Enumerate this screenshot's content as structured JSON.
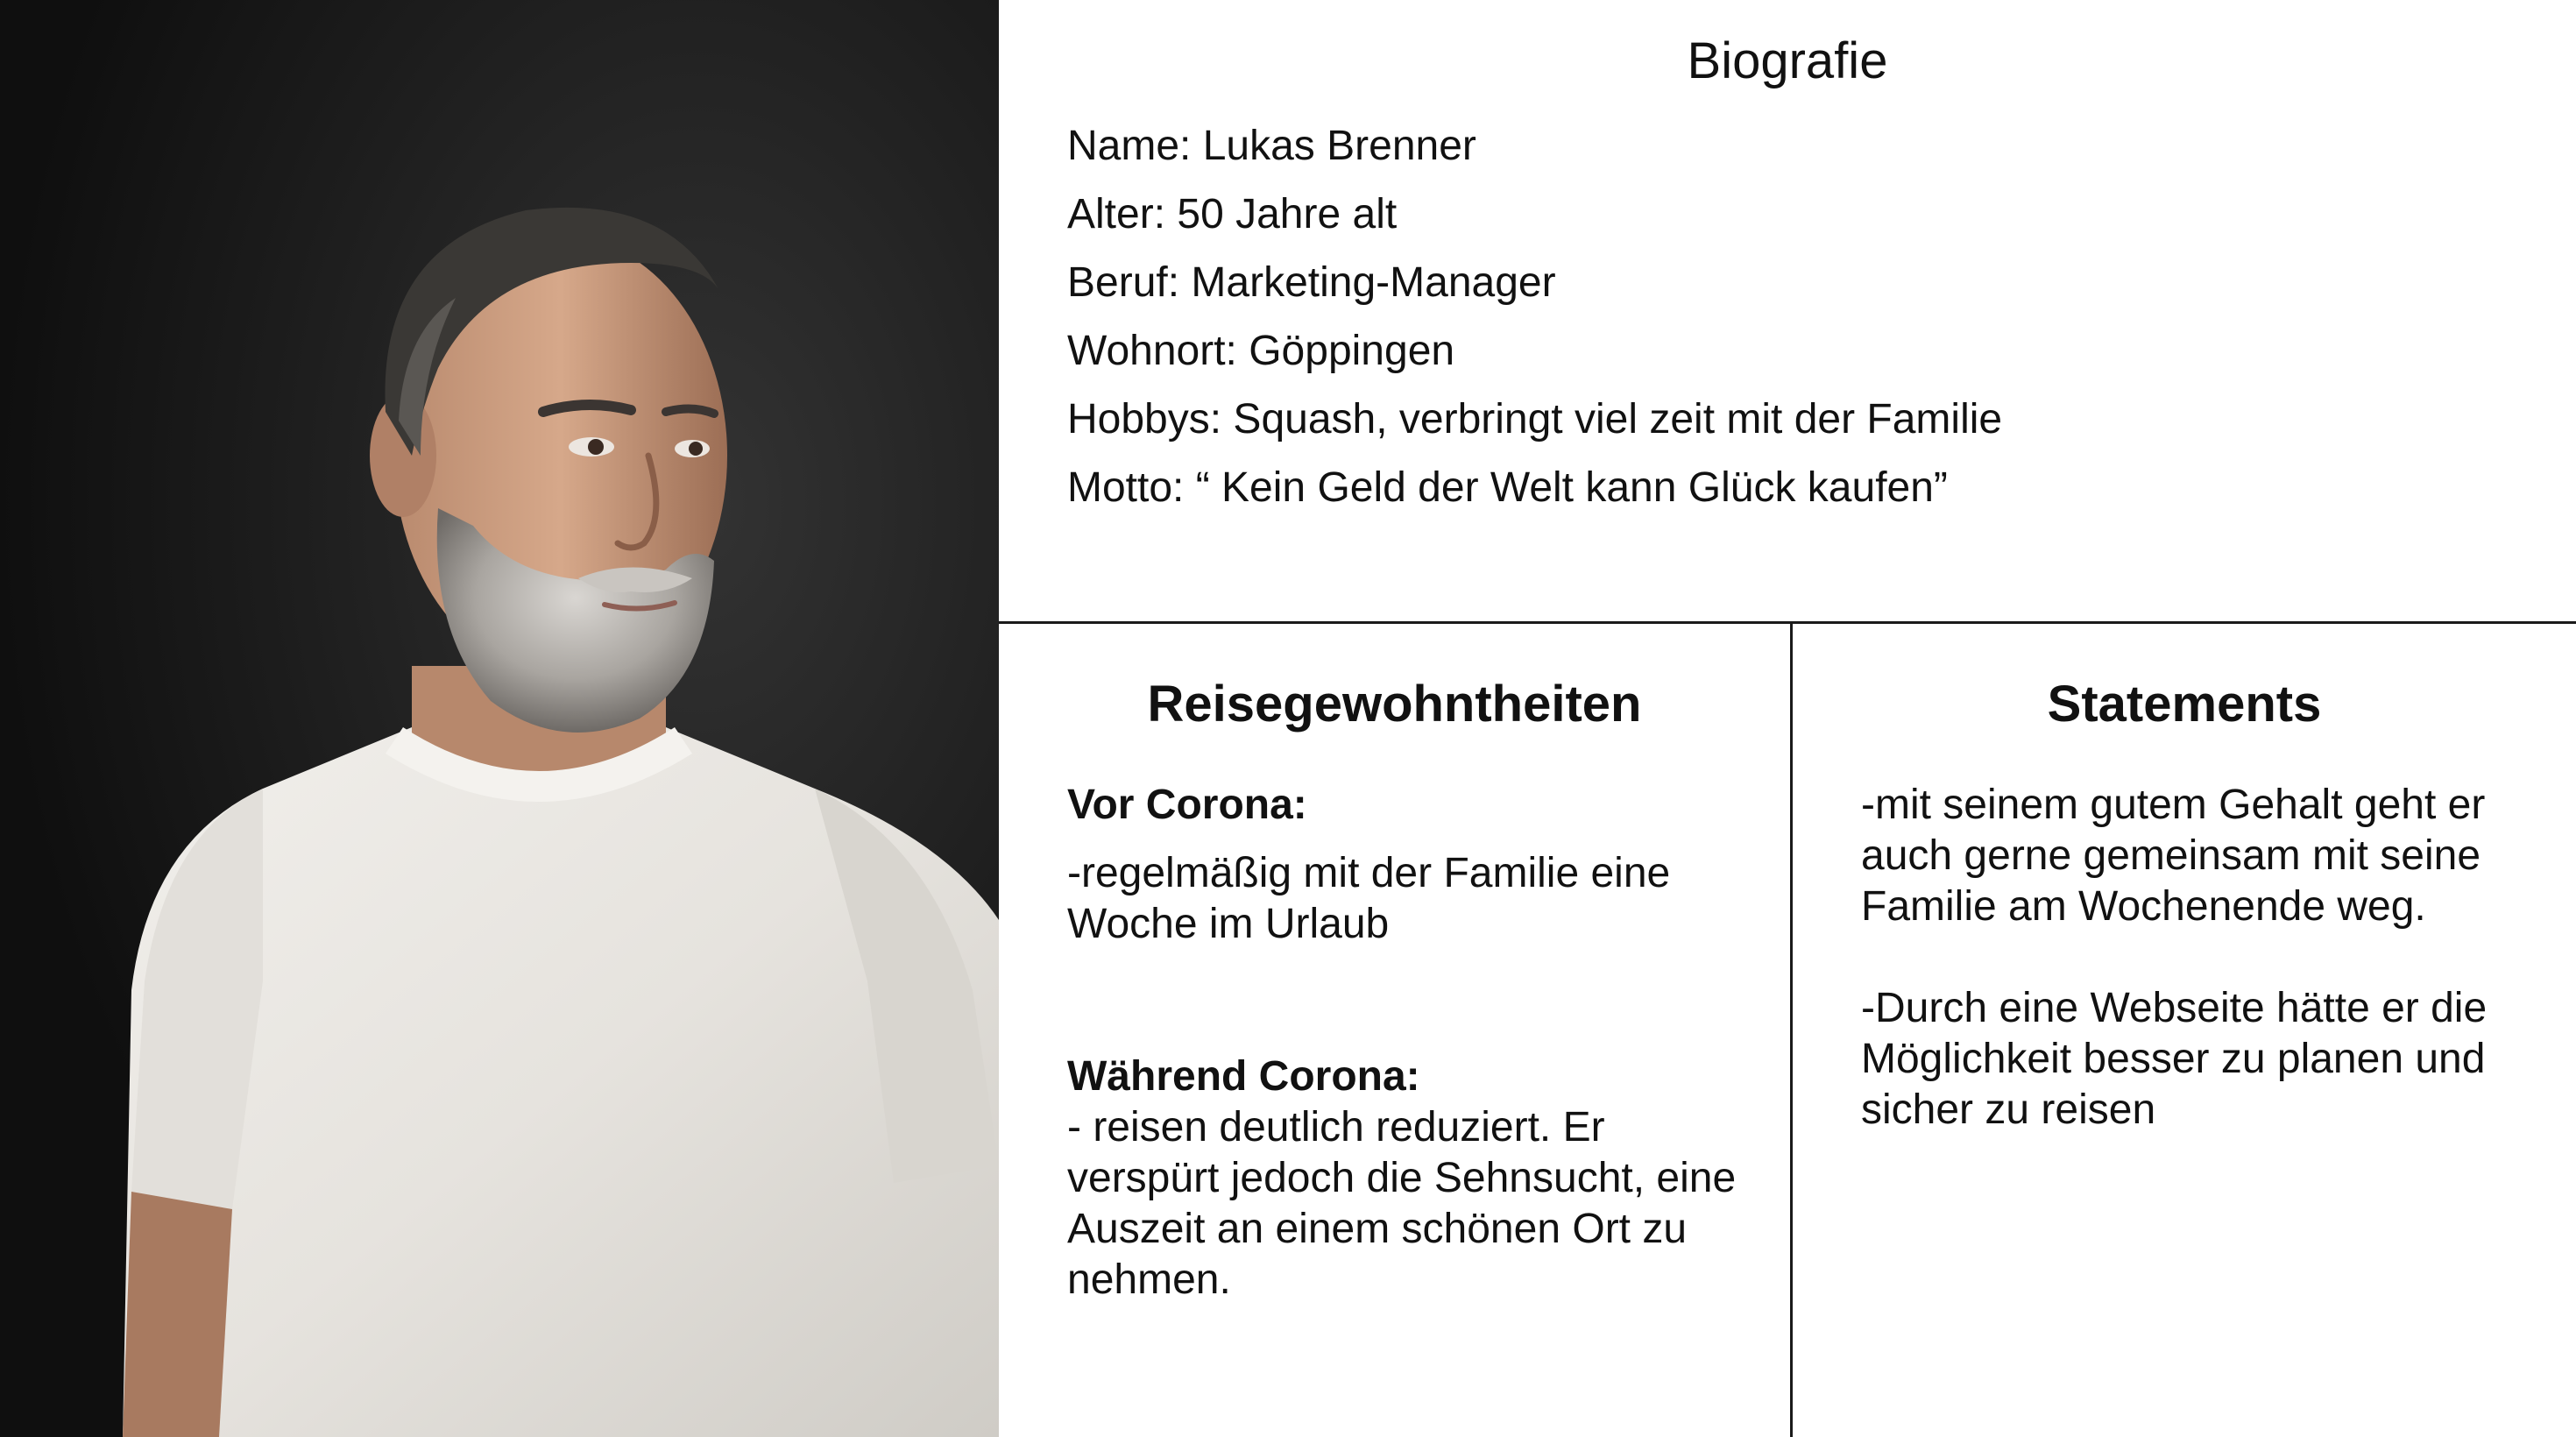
{
  "biography": {
    "title": "Biografie",
    "lines": [
      "Name: Lukas Brenner",
      "Alter: 50 Jahre alt",
      "Beruf: Marketing-Manager",
      "Wohnort: Göppingen",
      "Hobbys: Squash, verbringt viel zeit mit der Familie",
      "Motto: “ Kein Geld der Welt kann Glück kaufen”"
    ]
  },
  "travel_habits": {
    "title": "Reisegewohntheiten",
    "before": {
      "heading": "Vor Corona:",
      "text": "-regelmäßig mit der Familie eine Woche im Urlaub"
    },
    "during": {
      "heading": "Während Corona:",
      "text": "- reisen deutlich reduziert. Er verspürt jedoch die Sehnsucht, eine Auszeit an einem schönen Ort zu nehmen."
    }
  },
  "statements": {
    "title": "Statements",
    "items": [
      "-mit seinem gutem Gehalt geht er auch gerne gemeinsam mit seine Familie am Wochenende weg.",
      "-Durch eine Webseite hätte er die Möglichkeit besser zu planen und sicher zu reisen"
    ]
  },
  "colors": {
    "text": "#111111",
    "divider": "#1a1a1a",
    "photo_background": "#1c1c1c",
    "shirt": "#e9e7e3"
  }
}
